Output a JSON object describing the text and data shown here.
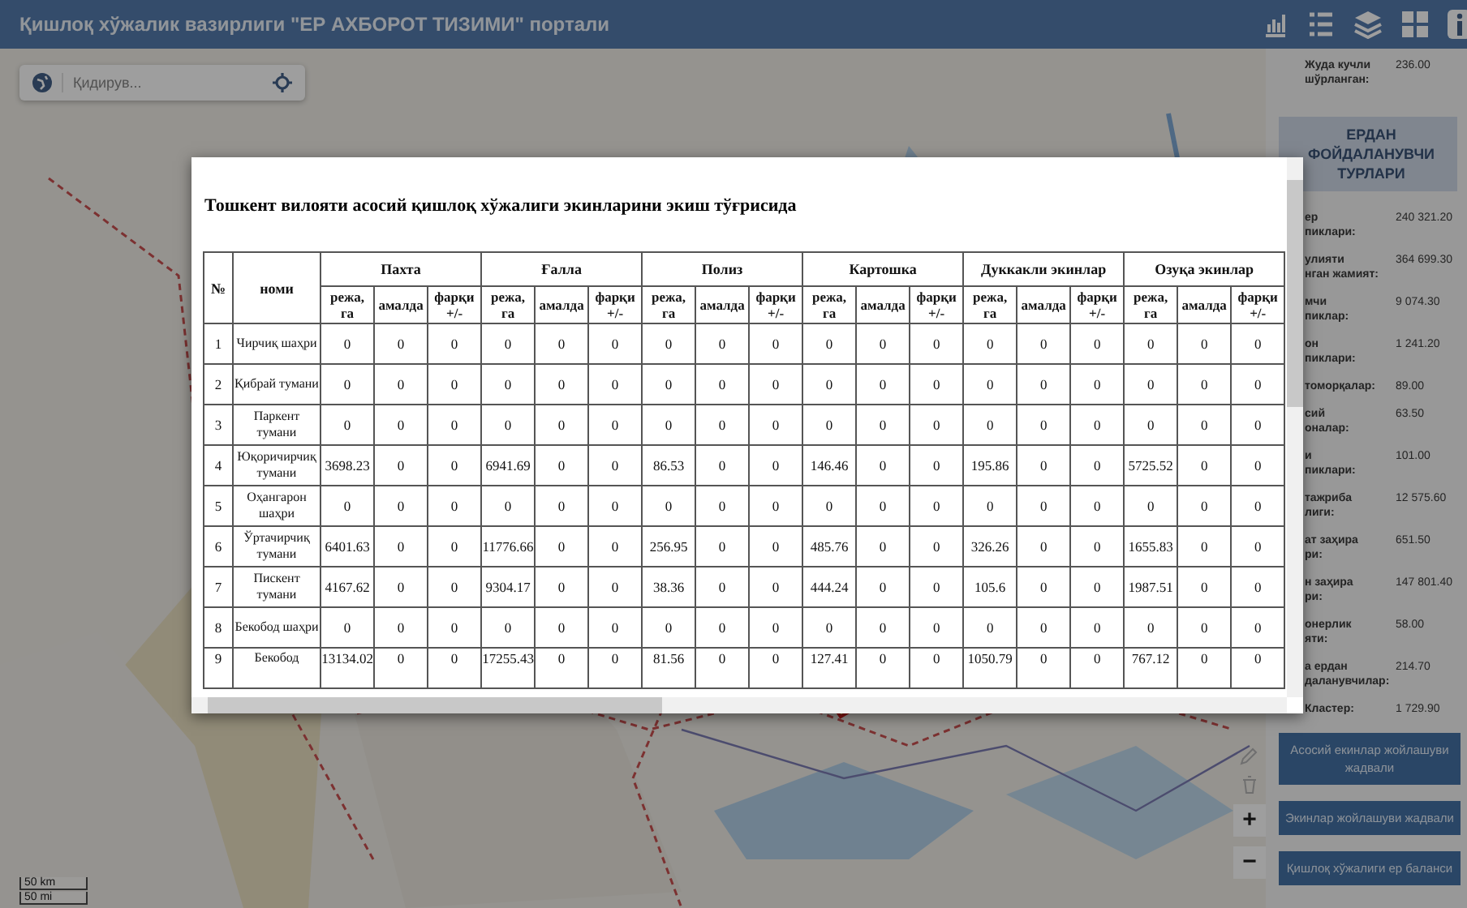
{
  "header": {
    "title": "Қишлоқ хўжалик вазирлиги \"ЕР АХБОРОТ ТИЗИМИ\" портали"
  },
  "search": {
    "placeholder": "Қидирув..."
  },
  "map": {
    "scale": [
      "50 km",
      "50 mi"
    ],
    "zoom_in": "+",
    "zoom_out": "−"
  },
  "side_panel": {
    "top_stat": {
      "label": "Жуда кучли\nшўрланган:",
      "value": "236.00"
    },
    "heading": "ЕРДАН ФОЙДАЛАНУВЧИ ТУРЛАРИ",
    "stats": [
      {
        "label": "ер\nпиклари:",
        "value": "240 321.20"
      },
      {
        "label": "улияти\nнган жамият:",
        "value": "364 699.30"
      },
      {
        "label": "мчи\nпиклар:",
        "value": "9 074.30"
      },
      {
        "label": "он\nпиклари:",
        "value": "1 241.20"
      },
      {
        "label": "томорқалар:",
        "value": "89.00"
      },
      {
        "label": "сий\nоналар:",
        "value": "63.50"
      },
      {
        "label": "и\nпиклари:",
        "value": "101.00"
      },
      {
        "label": "тажриба\nлиги:",
        "value": "12 575.60"
      },
      {
        "label": "ат заҳира\nри:",
        "value": "651.50"
      },
      {
        "label": "н заҳира\nри:",
        "value": "147 801.40"
      },
      {
        "label": "онерлик\nяти:",
        "value": "58.00"
      },
      {
        "label": "а ердан\nдаланувчилар:",
        "value": "214.70"
      },
      {
        "label": "Кластер:",
        "value": "1 729.90"
      }
    ],
    "buttons": [
      "Асосий екинлар жойлашуви жадвали",
      "Экинлар жойлашуви жадвали",
      "Қишлоқ хўжалиги ер баланси"
    ]
  },
  "modal": {
    "title": "Тошкент вилояти асосий қишлоқ хўжалиги экинларини экиш тўғрисида",
    "table": {
      "number_header": "№",
      "name_header": "номи",
      "groups": [
        {
          "label": "Пахта",
          "subcolumns": [
            "режа, га",
            "амалда",
            "фарқи +/-"
          ]
        },
        {
          "label": "Ғалла",
          "subcolumns": [
            "режа, га",
            "амалда",
            "фарқи +/-"
          ]
        },
        {
          "label": "Полиз",
          "subcolumns": [
            "режа, га",
            "амалда",
            "фарқи +/-"
          ]
        },
        {
          "label": "Картошка",
          "subcolumns": [
            "режа, га",
            "амалда",
            "фарқи +/-"
          ]
        },
        {
          "label": "Дуккакли экинлар",
          "subcolumns": [
            "режа, га",
            "амалда",
            "фарқи +/-"
          ]
        },
        {
          "label": "Озуқа экинлар",
          "subcolumns": [
            "режа, га",
            "амалда",
            "фарқи +/-"
          ]
        }
      ],
      "rows": [
        {
          "no": "1",
          "name": "Чирчиқ шаҳри",
          "cells": [
            "0",
            "0",
            "0",
            "0",
            "0",
            "0",
            "0",
            "0",
            "0",
            "0",
            "0",
            "0",
            "0",
            "0",
            "0",
            "0",
            "0",
            "0"
          ]
        },
        {
          "no": "2",
          "name": "Қибрай тумани",
          "cells": [
            "0",
            "0",
            "0",
            "0",
            "0",
            "0",
            "0",
            "0",
            "0",
            "0",
            "0",
            "0",
            "0",
            "0",
            "0",
            "0",
            "0",
            "0"
          ]
        },
        {
          "no": "3",
          "name": "Паркент тумани",
          "cells": [
            "0",
            "0",
            "0",
            "0",
            "0",
            "0",
            "0",
            "0",
            "0",
            "0",
            "0",
            "0",
            "0",
            "0",
            "0",
            "0",
            "0",
            "0"
          ]
        },
        {
          "no": "4",
          "name": "Юқоричирчиқ тумани",
          "cells": [
            "3698.23",
            "0",
            "0",
            "6941.69",
            "0",
            "0",
            "86.53",
            "0",
            "0",
            "146.46",
            "0",
            "0",
            "195.86",
            "0",
            "0",
            "5725.52",
            "0",
            "0"
          ]
        },
        {
          "no": "5",
          "name": "Оҳангарон шаҳри",
          "cells": [
            "0",
            "0",
            "0",
            "0",
            "0",
            "0",
            "0",
            "0",
            "0",
            "0",
            "0",
            "0",
            "0",
            "0",
            "0",
            "0",
            "0",
            "0"
          ]
        },
        {
          "no": "6",
          "name": "Ўртачирчиқ тумани",
          "cells": [
            "6401.63",
            "0",
            "0",
            "11776.66",
            "0",
            "0",
            "256.95",
            "0",
            "0",
            "485.76",
            "0",
            "0",
            "326.26",
            "0",
            "0",
            "1655.83",
            "0",
            "0"
          ]
        },
        {
          "no": "7",
          "name": "Пискент тумани",
          "cells": [
            "4167.62",
            "0",
            "0",
            "9304.17",
            "0",
            "0",
            "38.36",
            "0",
            "0",
            "444.24",
            "0",
            "0",
            "105.6",
            "0",
            "0",
            "1987.51",
            "0",
            "0"
          ]
        },
        {
          "no": "8",
          "name": "Бекобод шаҳри",
          "cells": [
            "0",
            "0",
            "0",
            "0",
            "0",
            "0",
            "0",
            "0",
            "0",
            "0",
            "0",
            "0",
            "0",
            "0",
            "0",
            "0",
            "0",
            "0"
          ]
        },
        {
          "no": "9",
          "name": "Бекобод",
          "cells": [
            "13134.02",
            "0",
            "0",
            "17255.43",
            "0",
            "0",
            "81.56",
            "0",
            "0",
            "127.41",
            "0",
            "0",
            "1050.79",
            "0",
            "0",
            "767.12",
            "0",
            "0"
          ]
        }
      ]
    }
  }
}
